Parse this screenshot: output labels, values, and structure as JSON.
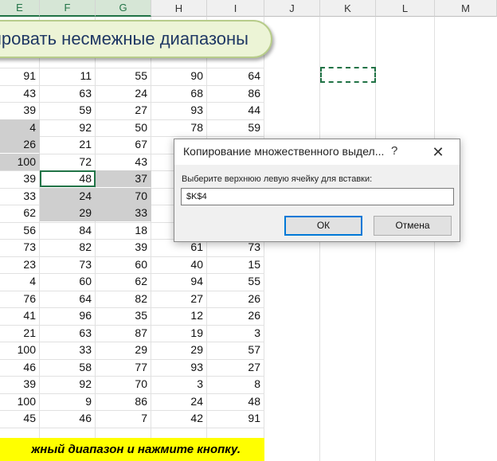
{
  "columns": [
    "E",
    "F",
    "G",
    "H",
    "I",
    "J",
    "K",
    "L",
    "M"
  ],
  "selected_columns": [
    "E",
    "F",
    "G"
  ],
  "banner_text": "ировать несмежные диапазоны",
  "rows": [
    [
      91,
      11,
      55,
      90,
      64
    ],
    [
      43,
      63,
      24,
      68,
      86
    ],
    [
      39,
      59,
      27,
      93,
      44
    ],
    [
      4,
      92,
      50,
      78,
      59
    ],
    [
      26,
      21,
      67,
      "",
      ""
    ],
    [
      100,
      72,
      43,
      "",
      ""
    ],
    [
      39,
      48,
      37,
      "",
      ""
    ],
    [
      33,
      24,
      70,
      "",
      ""
    ],
    [
      62,
      29,
      33,
      "",
      ""
    ],
    [
      56,
      84,
      18,
      "",
      ""
    ],
    [
      73,
      82,
      39,
      61,
      73
    ],
    [
      23,
      73,
      60,
      40,
      15
    ],
    [
      4,
      60,
      62,
      94,
      55
    ],
    [
      76,
      64,
      82,
      27,
      26
    ],
    [
      41,
      96,
      35,
      12,
      26
    ],
    [
      21,
      63,
      87,
      19,
      3
    ],
    [
      100,
      33,
      29,
      29,
      57
    ],
    [
      46,
      58,
      77,
      93,
      27
    ],
    [
      39,
      92,
      70,
      3,
      8
    ],
    [
      100,
      9,
      86,
      24,
      48
    ],
    [
      45,
      46,
      7,
      42,
      91
    ]
  ],
  "gray_cells": [
    [
      3,
      0
    ],
    [
      4,
      0
    ],
    [
      5,
      0
    ],
    [
      6,
      2
    ],
    [
      7,
      1
    ],
    [
      7,
      2
    ],
    [
      8,
      1
    ],
    [
      8,
      2
    ]
  ],
  "active_cell": [
    6,
    1
  ],
  "footer_instruction": "жный диапазон и нажмите кнопку.",
  "dialog": {
    "title": "Копирование множественного выдел...",
    "help_label": "?",
    "close_label": "✕",
    "prompt": "Выберите верхнюю левую ячейку для вставки:",
    "input_value": "$K$4",
    "ok_label": "ОК",
    "cancel_label": "Отмена"
  },
  "colors": {
    "accent": "#217346",
    "selection_fill": "#cfcfcf",
    "banner_fill": "#ecf4d6",
    "instruction_fill": "#ffff00"
  }
}
